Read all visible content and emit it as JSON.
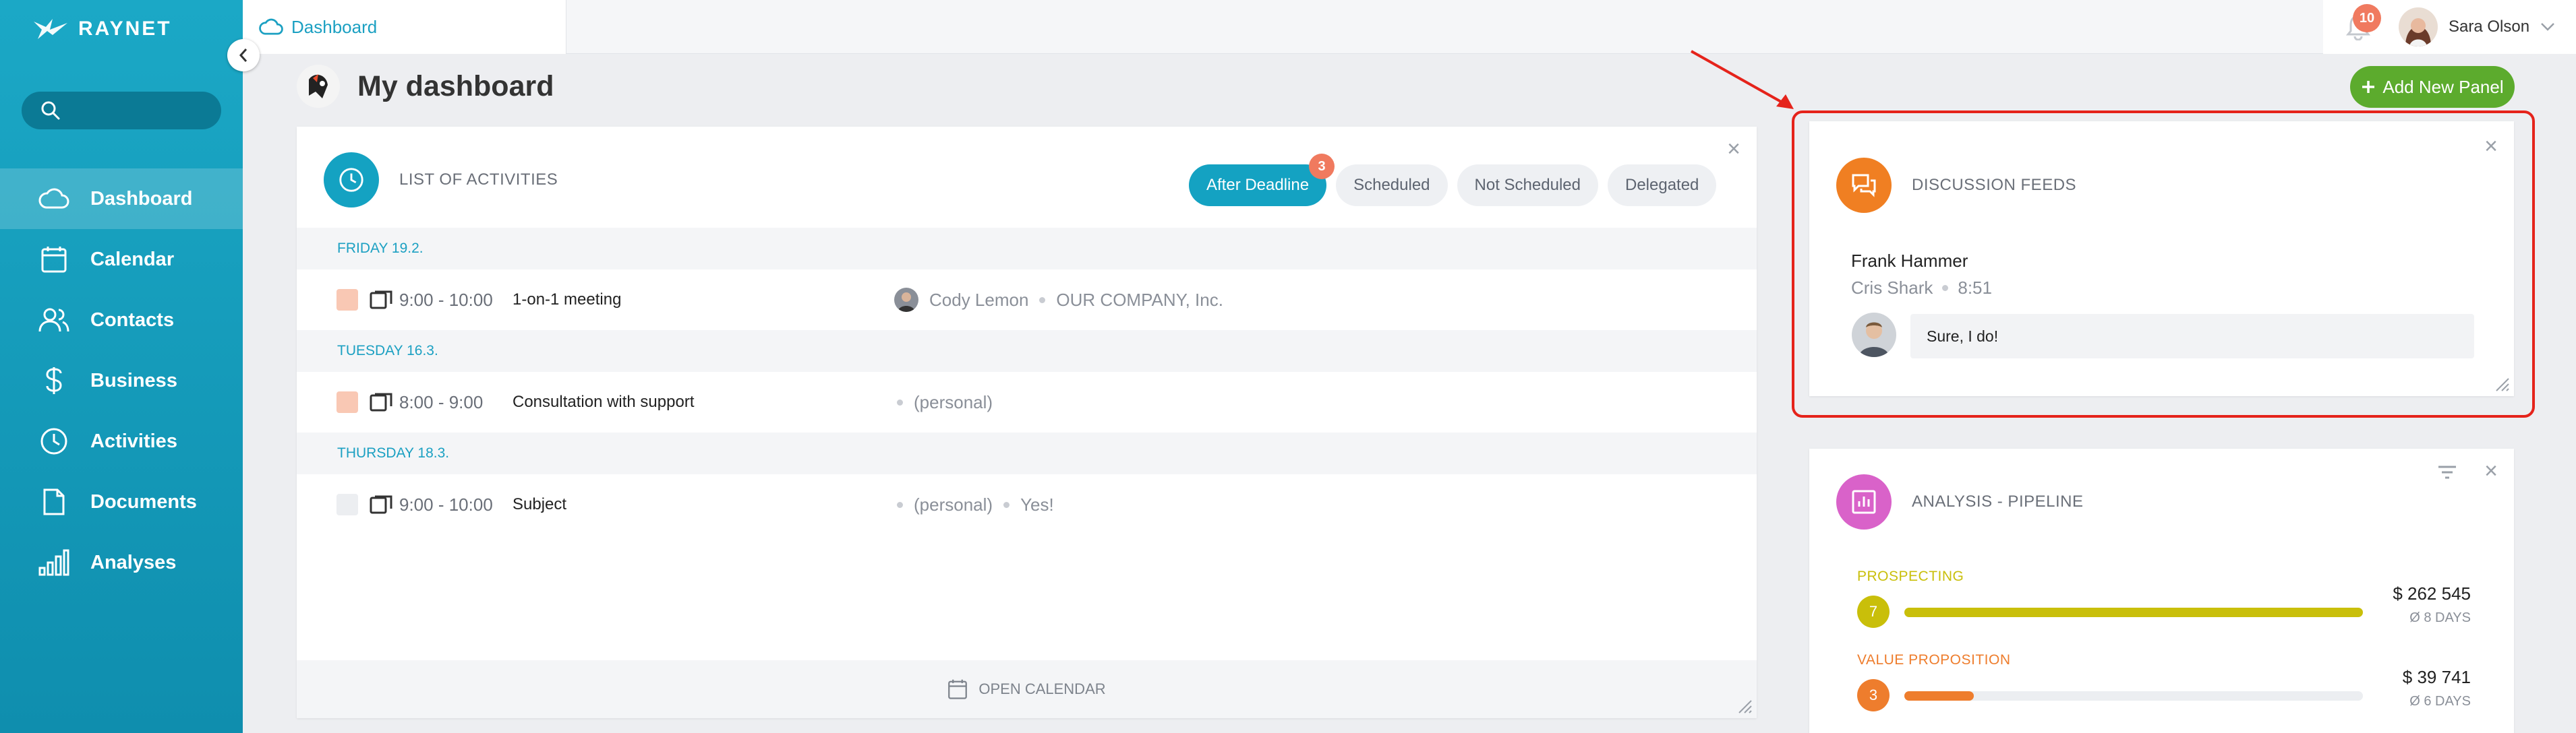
{
  "app": {
    "logo_text": "RAYNET"
  },
  "sidebar": {
    "search_placeholder": "",
    "items": [
      {
        "label": "Dashboard",
        "icon": "cloud-icon",
        "active": true
      },
      {
        "label": "Calendar",
        "icon": "calendar-icon"
      },
      {
        "label": "Contacts",
        "icon": "contacts-icon"
      },
      {
        "label": "Business",
        "icon": "dollar-icon"
      },
      {
        "label": "Activities",
        "icon": "clock-icon"
      },
      {
        "label": "Documents",
        "icon": "document-icon"
      },
      {
        "label": "Analyses",
        "icon": "bar-chart-icon"
      }
    ]
  },
  "topbar": {
    "tab_label": "Dashboard",
    "notification_count": "10",
    "user_name": "Sara Olson"
  },
  "page": {
    "title": "My dashboard",
    "add_panel_label": "Add New Panel"
  },
  "activities_panel": {
    "title": "LIST OF ACTIVITIES",
    "filters": [
      {
        "label": "After Deadline",
        "active": true,
        "badge": "3"
      },
      {
        "label": "Scheduled"
      },
      {
        "label": "Not Scheduled"
      },
      {
        "label": "Delegated"
      }
    ],
    "groups": [
      {
        "date": "FRIDAY 19.2.",
        "rows": [
          {
            "time": "9:00 - 10:00",
            "subject": "1-on-1 meeting",
            "person": "Cody Lemon",
            "company": "OUR COMPANY, Inc.",
            "status_color": "#f9c8b4"
          }
        ]
      },
      {
        "date": "TUESDAY 16.3.",
        "rows": [
          {
            "time": "8:00 - 9:00",
            "subject": "Consultation with support",
            "company": "(personal)",
            "status_color": "#f9c8b4"
          }
        ]
      },
      {
        "date": "THURSDAY 18.3.",
        "rows": [
          {
            "time": "9:00 - 10:00",
            "subject": "Subject",
            "company": "(personal)",
            "extra": "Yes!",
            "status_color": "#eceef1"
          }
        ]
      }
    ],
    "footer_label": "OPEN CALENDAR"
  },
  "discussion_panel": {
    "title": "DISCUSSION FEEDS",
    "author": "Frank Hammer",
    "recipient": "Cris Shark",
    "time": "8:51",
    "message": "Sure, I do!"
  },
  "pipeline_panel": {
    "title": "ANALYSIS - PIPELINE",
    "stages": [
      {
        "name": "PROSPECTING",
        "count": "7",
        "amount": "$ 262 545",
        "days": "Ø 8 DAYS",
        "fill": 1.0,
        "color": "#c9bf0a"
      },
      {
        "name": "VALUE PROPOSITION",
        "count": "3",
        "amount": "$ 39 741",
        "days": "Ø 6 DAYS",
        "fill": 0.151,
        "color": "#ee7d2d"
      }
    ]
  },
  "colors": {
    "accent": "#14a2c2",
    "add_button": "#5cab2d",
    "annotation": "#e5231b"
  }
}
